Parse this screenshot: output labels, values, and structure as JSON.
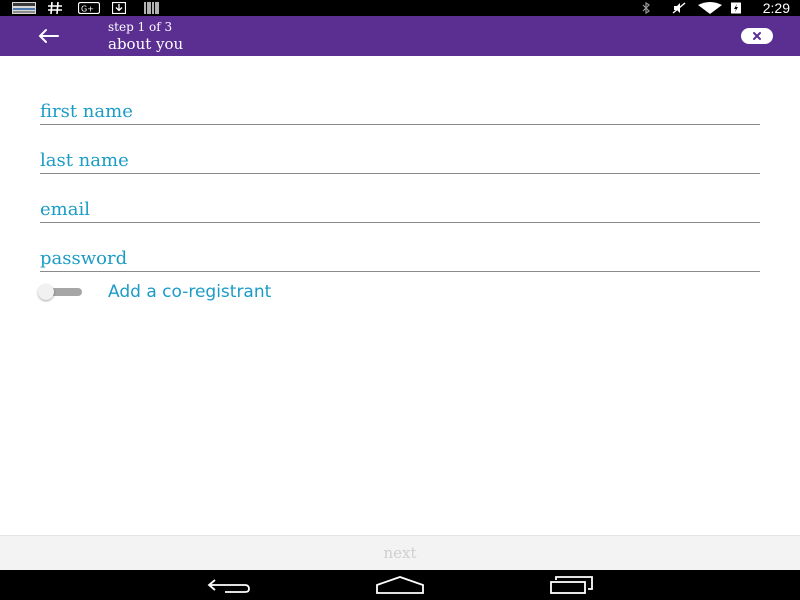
{
  "status_bar": {
    "time": "2:29",
    "left_icons": [
      "wsj-news-icon",
      "hashtag-icon",
      "google-plus-icon",
      "download-icon",
      "barcode-icon"
    ],
    "right_icons": [
      "bluetooth-icon",
      "mute-icon",
      "wifi-icon",
      "battery-charging-icon"
    ]
  },
  "toolbar": {
    "step_label": "step 1 of 3",
    "title": "about you",
    "background_color": "#5b2e92"
  },
  "form": {
    "first_name_placeholder": "first name",
    "last_name_placeholder": "last name",
    "email_placeholder": "email",
    "password_placeholder": "password",
    "co_registrant_label": "Add a co-registrant",
    "co_registrant_enabled": false,
    "accent_color": "#1a9cc6"
  },
  "footer": {
    "next_label": "next",
    "next_enabled": false
  },
  "nav_bar": {
    "buttons": [
      "back-icon",
      "home-icon",
      "recent-apps-icon"
    ]
  }
}
